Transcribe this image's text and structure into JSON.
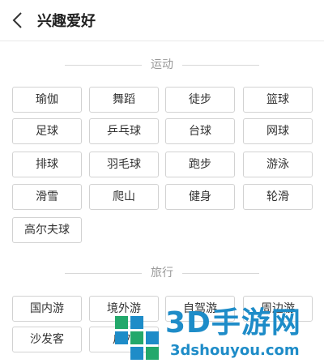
{
  "header": {
    "title": "兴趣爱好"
  },
  "sections": [
    {
      "name": "运动",
      "tags": [
        "瑜伽",
        "舞蹈",
        "徒步",
        "篮球",
        "足球",
        "乒乓球",
        "台球",
        "网球",
        "排球",
        "羽毛球",
        "跑步",
        "游泳",
        "滑雪",
        "爬山",
        "健身",
        "轮滑",
        "高尔夫球"
      ]
    },
    {
      "name": "旅行",
      "tags": [
        "国内游",
        "境外游",
        "自驾游",
        "周边游",
        "沙发客",
        "户外"
      ]
    }
  ],
  "watermark": {
    "brand": "3D手游网",
    "domain": "3dshouyou.com"
  },
  "colors": {
    "accent": "#1e8cc8",
    "tag_border": "#d2d2d2",
    "text": "#333333"
  },
  "icons": {
    "back": "chevron-left-icon"
  }
}
